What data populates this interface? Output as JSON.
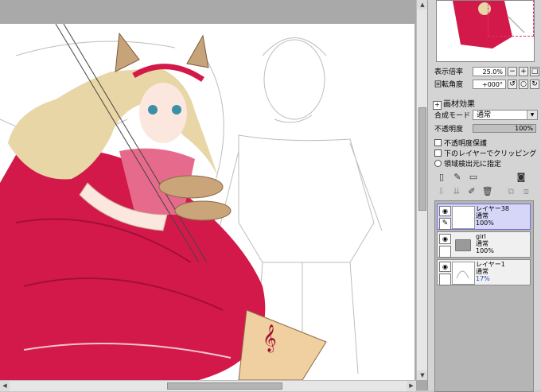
{
  "canvas": {
    "description_name": "drawing-canvas"
  },
  "navigator": {},
  "zoom": {
    "label": "表示倍率",
    "value": "25.0%"
  },
  "rotation": {
    "label": "回転角度",
    "value": "+000°"
  },
  "section": {
    "plus": "+",
    "label": "画材効果"
  },
  "blend": {
    "label": "合成モード",
    "value": "通常"
  },
  "opacity": {
    "label": "不透明度",
    "value": "100%"
  },
  "options": [
    {
      "label": "不透明度保護"
    },
    {
      "label": "下のレイヤーでクリッピング"
    },
    {
      "label": "領域検出元に指定"
    }
  ],
  "layers": [
    {
      "name": "レイヤー38",
      "mode": "通常",
      "opacity": "100%"
    },
    {
      "name": "girl",
      "mode": "通常",
      "opacity": "100%"
    },
    {
      "name": "レイヤー1",
      "mode": "通常",
      "opacity": "17%"
    }
  ],
  "colors": {
    "dress": "#d3194a",
    "selected_layer": "#d6d6f8",
    "panel": "#d4d4d4"
  }
}
